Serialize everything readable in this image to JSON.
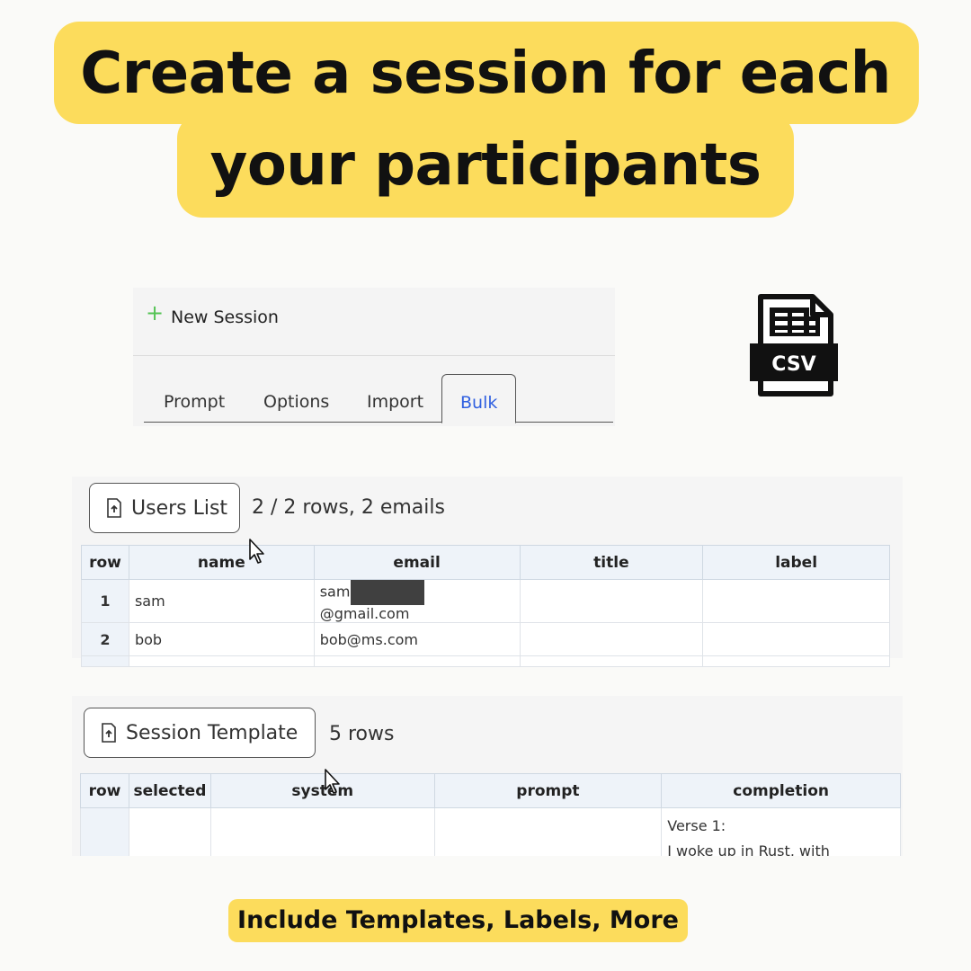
{
  "headline": {
    "line1": "Create a session for each",
    "line2": "your participants"
  },
  "session": {
    "new_label": "New Session",
    "tabs": [
      {
        "label": "Prompt"
      },
      {
        "label": "Options"
      },
      {
        "label": "Import"
      },
      {
        "label": "Bulk",
        "active": true
      }
    ]
  },
  "csv_icon": {
    "label": "CSV",
    "icon": "csv-file-icon"
  },
  "users": {
    "button_label": "Users List",
    "summary": "2 / 2 rows, 2 emails",
    "columns": [
      "row",
      "name",
      "email",
      "title",
      "label"
    ],
    "rows": [
      {
        "row": "1",
        "name": "sam",
        "email_prefix": "sam",
        "email_suffix": "@gmail.com",
        "title": "",
        "label": ""
      },
      {
        "row": "2",
        "name": "bob",
        "email": "bob@ms.com",
        "title": "",
        "label": ""
      }
    ]
  },
  "template": {
    "button_label": "Session Template",
    "summary": "5 rows",
    "columns": [
      "row",
      "selected",
      "system",
      "prompt",
      "completion"
    ],
    "first_row": {
      "row": "",
      "selected": "",
      "system": "",
      "prompt": "",
      "completion_line1": "Verse 1:",
      "completion_line2": "I woke up in Rust, with"
    }
  },
  "footer": {
    "label": "Include Templates, Labels, More"
  },
  "colors": {
    "accent_yellow": "#fcdc5c",
    "active_tab": "#2f5fe0",
    "plus_green": "#54c354"
  }
}
